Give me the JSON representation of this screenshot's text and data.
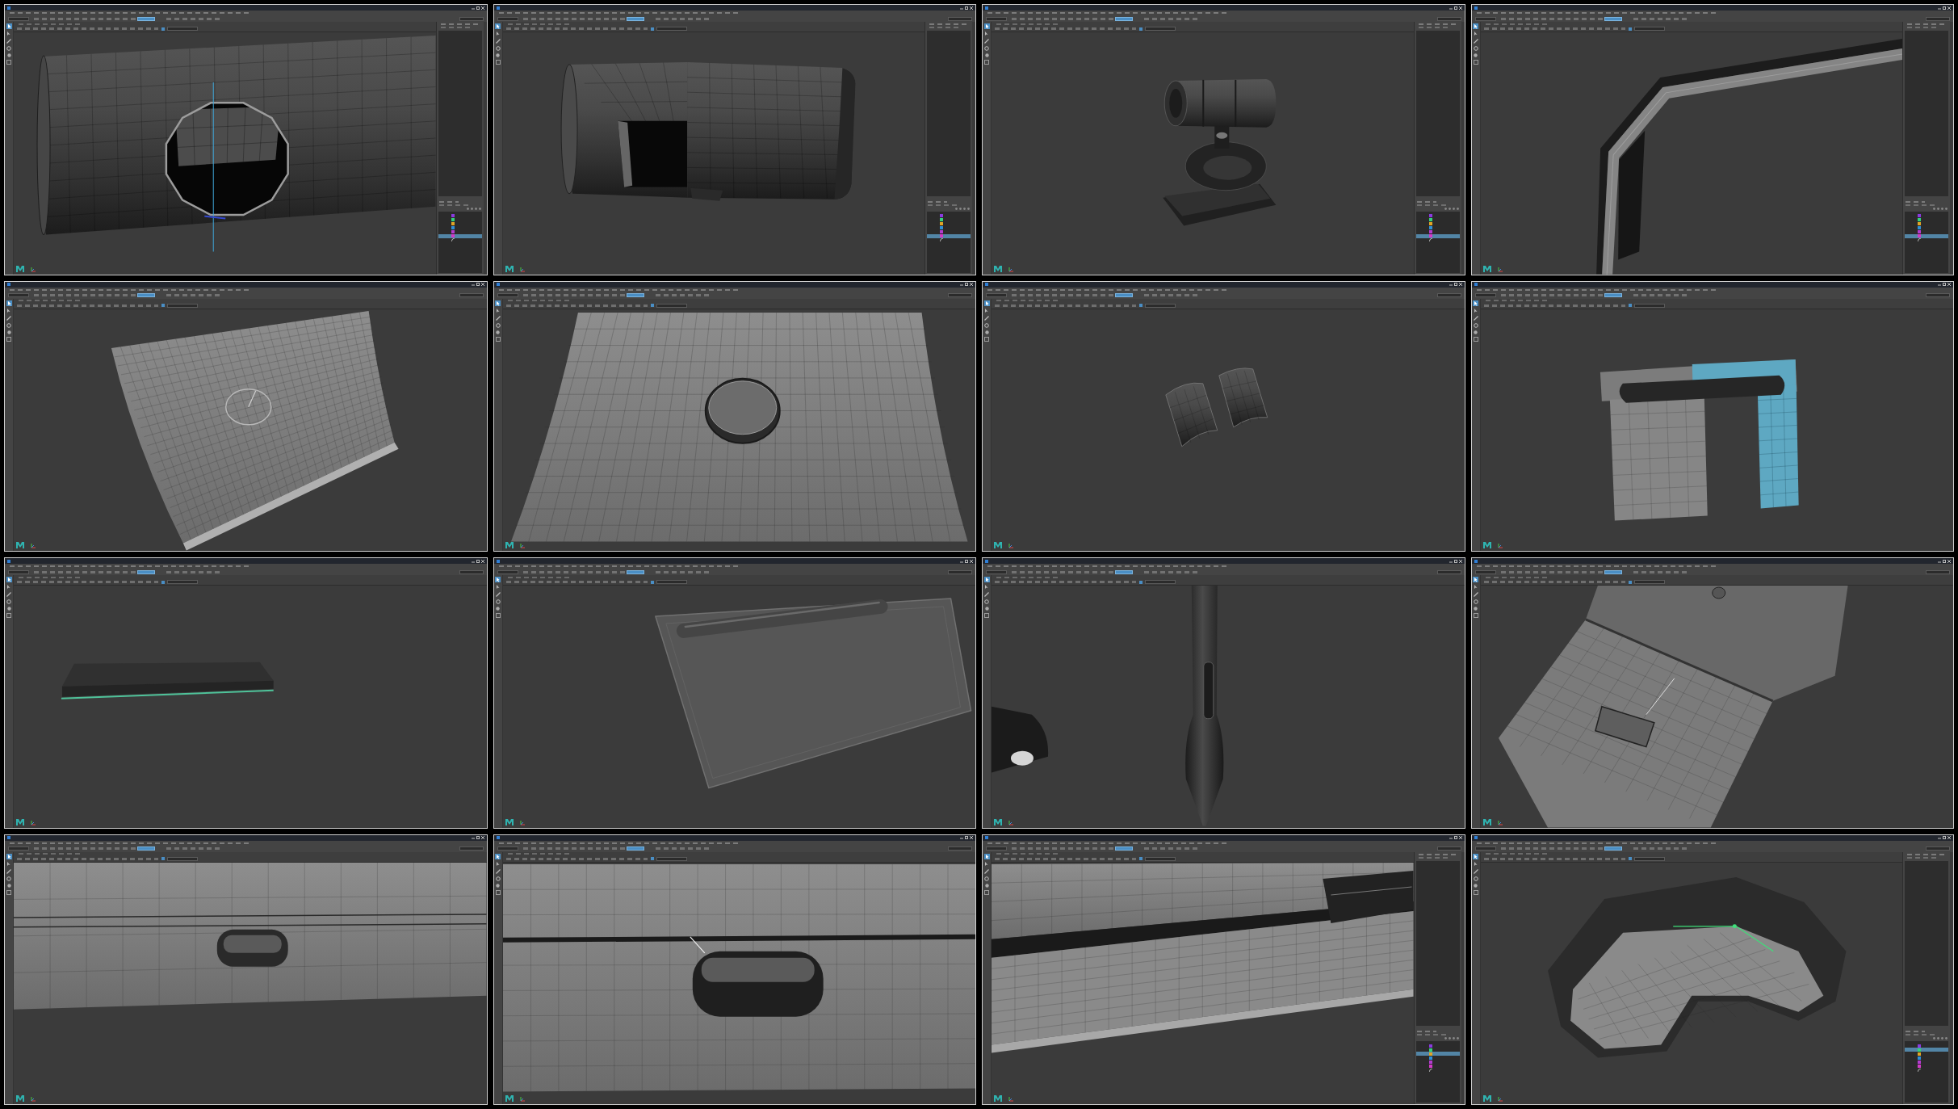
{
  "tiles": [
    {
      "kind": "tube",
      "outliner": [
        {
          "kind": "mesh",
          "color": "#8a3be0",
          "selected": false
        },
        {
          "kind": "mesh",
          "color": "#33d17a",
          "selected": false
        },
        {
          "kind": "mesh",
          "color": "#e0a526",
          "selected": false
        },
        {
          "kind": "mesh",
          "color": "#2f8fd8",
          "selected": false
        },
        {
          "kind": "mesh",
          "color": "#b33bd0",
          "selected": false
        },
        {
          "kind": "mesh",
          "color": "#d23bc8",
          "selected": true
        },
        {
          "kind": "curve",
          "selected": false
        }
      ]
    },
    {
      "kind": "cylinder",
      "outliner": [
        {
          "kind": "mesh",
          "color": "#8a3be0",
          "selected": false
        },
        {
          "kind": "mesh",
          "color": "#33d17a",
          "selected": false
        },
        {
          "kind": "mesh",
          "color": "#e0a526",
          "selected": false
        },
        {
          "kind": "mesh",
          "color": "#2f8fd8",
          "selected": false
        },
        {
          "kind": "mesh",
          "color": "#b33bd0",
          "selected": false
        },
        {
          "kind": "mesh",
          "color": "#d23bc8",
          "selected": true
        },
        {
          "kind": "curve",
          "selected": false
        }
      ]
    },
    {
      "kind": "clip",
      "outliner": [
        {
          "kind": "mesh",
          "color": "#8a3be0",
          "selected": false
        },
        {
          "kind": "mesh",
          "color": "#33d17a",
          "selected": false
        },
        {
          "kind": "mesh",
          "color": "#e0a526",
          "selected": false
        },
        {
          "kind": "mesh",
          "color": "#2f8fd8",
          "selected": false
        },
        {
          "kind": "mesh",
          "color": "#b33bd0",
          "selected": false
        },
        {
          "kind": "mesh",
          "color": "#d23bc8",
          "selected": true
        },
        {
          "kind": "curve",
          "selected": false
        }
      ]
    },
    {
      "kind": "frame",
      "outliner": [
        {
          "kind": "mesh",
          "color": "#8a3be0",
          "selected": false
        },
        {
          "kind": "mesh",
          "color": "#33d17a",
          "selected": false
        },
        {
          "kind": "mesh",
          "color": "#e0a526",
          "selected": false
        },
        {
          "kind": "mesh",
          "color": "#2f8fd8",
          "selected": false
        },
        {
          "kind": "mesh",
          "color": "#b33bd0",
          "selected": false
        },
        {
          "kind": "mesh",
          "color": "#d23bc8",
          "selected": true
        },
        {
          "kind": "curve",
          "selected": false
        }
      ]
    },
    {
      "kind": "sheet"
    },
    {
      "kind": "surface"
    },
    {
      "kind": "clips"
    },
    {
      "kind": "plate"
    },
    {
      "kind": "slab"
    },
    {
      "kind": "tablet"
    },
    {
      "kind": "stylus"
    },
    {
      "kind": "hinge"
    },
    {
      "kind": "slot"
    },
    {
      "kind": "closeup"
    },
    {
      "kind": "body",
      "outliner": [
        {
          "kind": "mesh",
          "color": "#8a3be0",
          "selected": false
        },
        {
          "kind": "mesh",
          "color": "#33d17a",
          "selected": false
        },
        {
          "kind": "mesh",
          "color": "#e0a526",
          "selected": true
        },
        {
          "kind": "mesh",
          "color": "#2f8fd8",
          "selected": false
        },
        {
          "kind": "mesh",
          "color": "#b33bd0",
          "selected": false
        },
        {
          "kind": "mesh",
          "color": "#d23bc8",
          "selected": false
        },
        {
          "kind": "curve",
          "selected": false
        }
      ]
    },
    {
      "kind": "shell",
      "outliner": [
        {
          "kind": "mesh",
          "color": "#8a3be0",
          "selected": false
        },
        {
          "kind": "mesh",
          "color": "#33d17a",
          "selected": true
        },
        {
          "kind": "mesh",
          "color": "#e0a526",
          "selected": false
        },
        {
          "kind": "mesh",
          "color": "#2f8fd8",
          "selected": false
        },
        {
          "kind": "mesh",
          "color": "#b33bd0",
          "selected": false
        },
        {
          "kind": "mesh",
          "color": "#d23bc8",
          "selected": false
        },
        {
          "kind": "curve",
          "selected": false
        }
      ]
    }
  ]
}
